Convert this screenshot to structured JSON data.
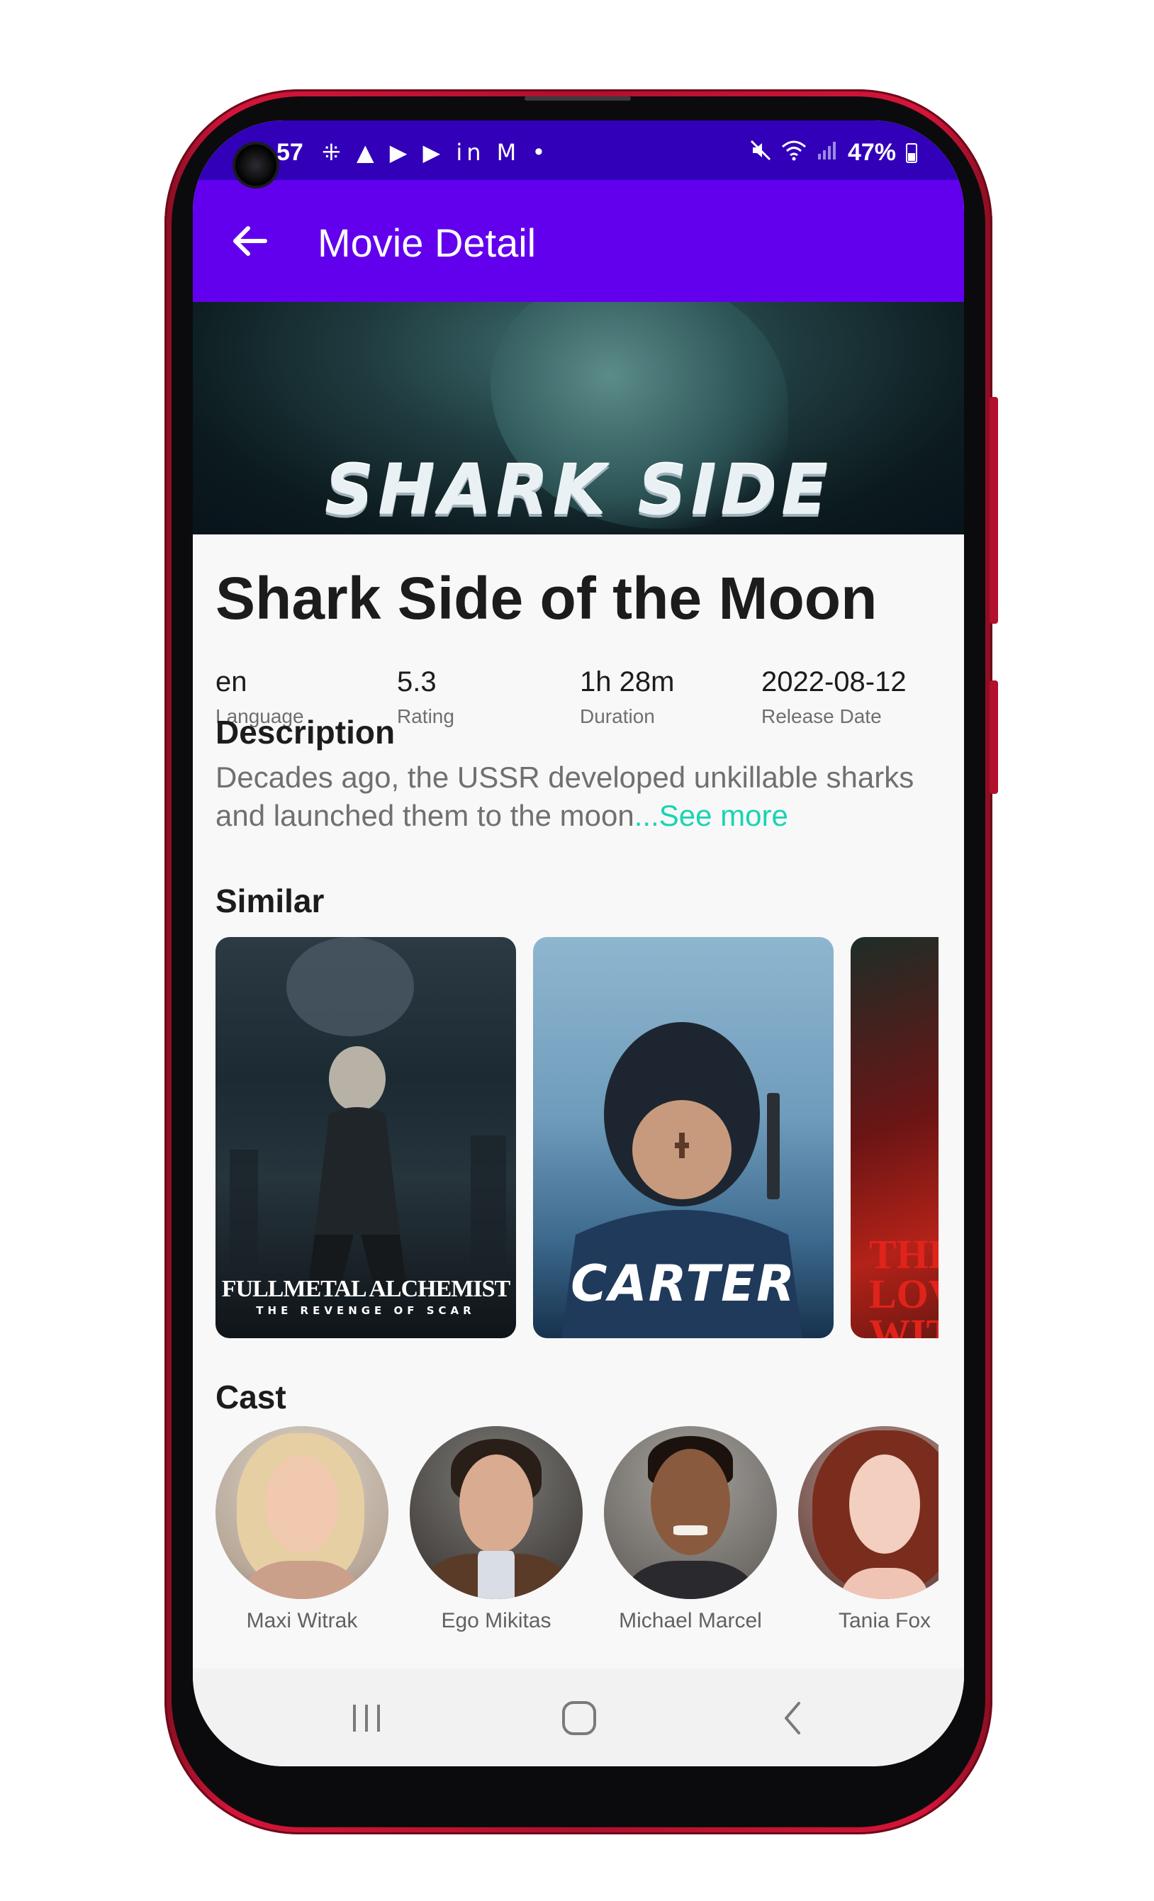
{
  "status_bar": {
    "time": "57",
    "notification_icons": "⁜ ▲ ▶ ▶ in M •",
    "battery": "47%"
  },
  "app_bar": {
    "title": "Movie Detail"
  },
  "banner": {
    "title": "SHARK SIDE"
  },
  "movie": {
    "title": "Shark Side of the Moon",
    "stats": [
      {
        "value": "en",
        "label": "Language"
      },
      {
        "value": "5.3",
        "label": "Rating"
      },
      {
        "value": "1h 28m",
        "label": "Duration"
      },
      {
        "value": "2022-08-12",
        "label": "Release Date"
      }
    ],
    "description_heading": "Description",
    "description": "Decades ago, the USSR developed unkillable sharks and launched them to the moon",
    "see_more": "...See more"
  },
  "similar": {
    "heading": "Similar",
    "posters": [
      {
        "title": "FULLMETAL ALCHEMIST",
        "subtitle": "THE REVENGE OF SCAR"
      },
      {
        "title": "CARTER"
      },
      {
        "title": "THE LOVE WIT"
      }
    ]
  },
  "cast": {
    "heading": "Cast",
    "members": [
      {
        "name": "Maxi Witrak"
      },
      {
        "name": "Ego Mikitas"
      },
      {
        "name": "Michael Marcel"
      },
      {
        "name": "Tania Fox"
      }
    ]
  },
  "colors": {
    "status_bar": "#3200b8",
    "app_bar": "#6200ee",
    "see_more": "#18d4b4",
    "phone_frame": "#d4153a"
  },
  "icons": {
    "back": "arrow-left",
    "mute": "speaker-muted",
    "wifi": "wifi",
    "signal": "cell-signal",
    "battery": "battery",
    "nav_recents": "three-bars",
    "nav_home": "rounded-square",
    "nav_back": "chevron-left"
  }
}
